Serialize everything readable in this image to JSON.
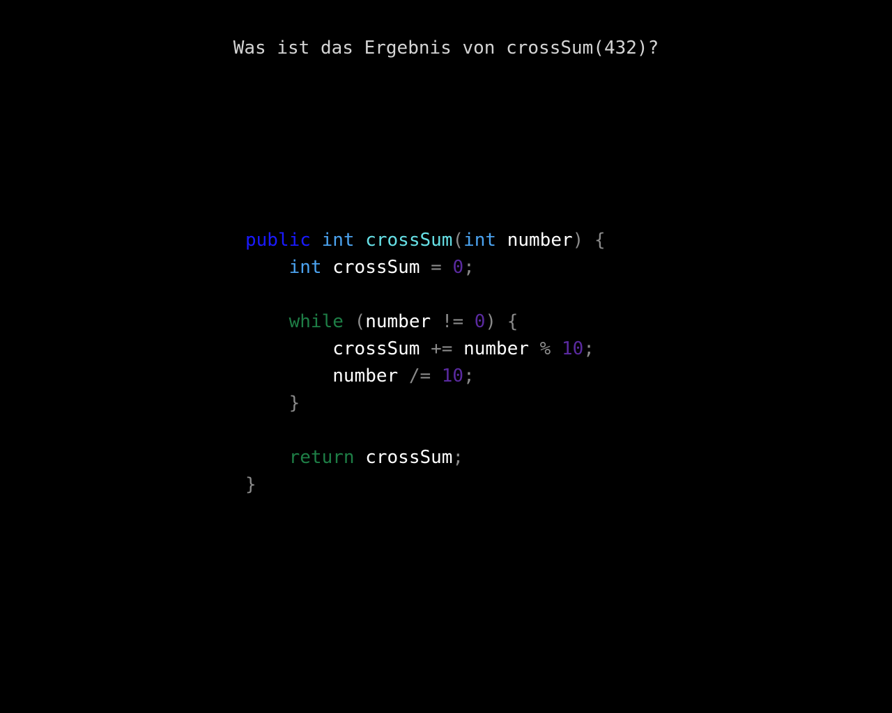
{
  "question": "Was ist das Ergebnis von crossSum(432)?",
  "colors": {
    "background": "#000000",
    "question_text": "#d4d4d4",
    "keyword_public": "#1a1aff",
    "type": "#4ba3f0",
    "function_name": "#66e0e6",
    "identifier": "#ffffff",
    "punctuation": "#8a8a8a",
    "number": "#5a2aa0",
    "control_keyword": "#1e7e46"
  },
  "code": {
    "language": "java",
    "lines": [
      {
        "tokens": [
          {
            "t": "public",
            "c": "keyword-public"
          },
          {
            "t": " ",
            "c": "ident"
          },
          {
            "t": "int",
            "c": "type"
          },
          {
            "t": " ",
            "c": "ident"
          },
          {
            "t": "crossSum",
            "c": "fn"
          },
          {
            "t": "(",
            "c": "punct"
          },
          {
            "t": "int",
            "c": "type"
          },
          {
            "t": " ",
            "c": "ident"
          },
          {
            "t": "number",
            "c": "ident"
          },
          {
            "t": ")",
            "c": "punct"
          },
          {
            "t": " ",
            "c": "ident"
          },
          {
            "t": "{",
            "c": "punct"
          }
        ]
      },
      {
        "tokens": [
          {
            "t": "    ",
            "c": "ident"
          },
          {
            "t": "int",
            "c": "type"
          },
          {
            "t": " ",
            "c": "ident"
          },
          {
            "t": "crossSum",
            "c": "ident"
          },
          {
            "t": " ",
            "c": "ident"
          },
          {
            "t": "=",
            "c": "punct"
          },
          {
            "t": " ",
            "c": "ident"
          },
          {
            "t": "0",
            "c": "number"
          },
          {
            "t": ";",
            "c": "punct"
          }
        ]
      },
      {
        "tokens": []
      },
      {
        "tokens": [
          {
            "t": "    ",
            "c": "ident"
          },
          {
            "t": "while",
            "c": "control"
          },
          {
            "t": " ",
            "c": "ident"
          },
          {
            "t": "(",
            "c": "punct"
          },
          {
            "t": "number",
            "c": "ident"
          },
          {
            "t": " ",
            "c": "ident"
          },
          {
            "t": "!=",
            "c": "punct"
          },
          {
            "t": " ",
            "c": "ident"
          },
          {
            "t": "0",
            "c": "number"
          },
          {
            "t": ")",
            "c": "punct"
          },
          {
            "t": " ",
            "c": "ident"
          },
          {
            "t": "{",
            "c": "punct"
          }
        ]
      },
      {
        "tokens": [
          {
            "t": "        ",
            "c": "ident"
          },
          {
            "t": "crossSum",
            "c": "ident"
          },
          {
            "t": " ",
            "c": "ident"
          },
          {
            "t": "+=",
            "c": "punct"
          },
          {
            "t": " ",
            "c": "ident"
          },
          {
            "t": "number",
            "c": "ident"
          },
          {
            "t": " ",
            "c": "ident"
          },
          {
            "t": "%",
            "c": "punct"
          },
          {
            "t": " ",
            "c": "ident"
          },
          {
            "t": "10",
            "c": "number"
          },
          {
            "t": ";",
            "c": "punct"
          }
        ]
      },
      {
        "tokens": [
          {
            "t": "        ",
            "c": "ident"
          },
          {
            "t": "number",
            "c": "ident"
          },
          {
            "t": " ",
            "c": "ident"
          },
          {
            "t": "/=",
            "c": "punct"
          },
          {
            "t": " ",
            "c": "ident"
          },
          {
            "t": "10",
            "c": "number"
          },
          {
            "t": ";",
            "c": "punct"
          }
        ]
      },
      {
        "tokens": [
          {
            "t": "    ",
            "c": "ident"
          },
          {
            "t": "}",
            "c": "punct"
          }
        ]
      },
      {
        "tokens": []
      },
      {
        "tokens": [
          {
            "t": "    ",
            "c": "ident"
          },
          {
            "t": "return",
            "c": "control"
          },
          {
            "t": " ",
            "c": "ident"
          },
          {
            "t": "crossSum",
            "c": "ident"
          },
          {
            "t": ";",
            "c": "punct"
          }
        ]
      },
      {
        "tokens": [
          {
            "t": "}",
            "c": "punct"
          }
        ]
      }
    ]
  }
}
